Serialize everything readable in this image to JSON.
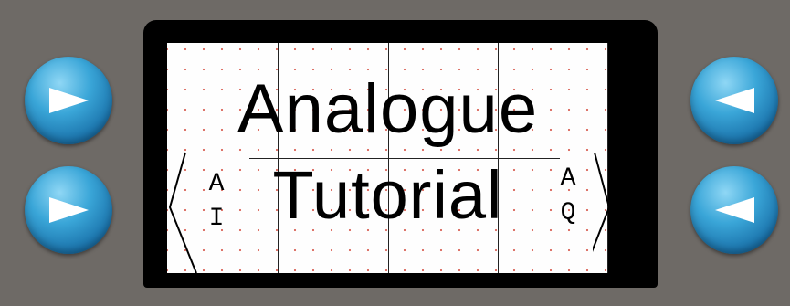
{
  "display": {
    "line1": "Analogue",
    "line2": "Tutorial",
    "left_label": [
      "A",
      "I"
    ],
    "right_label": [
      "A",
      "Q"
    ]
  },
  "buttons": {
    "left_top": {
      "icon": "arrow-right-icon"
    },
    "left_bottom": {
      "icon": "arrow-right-icon"
    },
    "right_top": {
      "icon": "arrow-left-icon"
    },
    "right_bottom": {
      "icon": "arrow-left-icon"
    }
  },
  "colors": {
    "panel": "#6e6a66",
    "bezel": "#000000",
    "screen": "#fefefe",
    "button_blue": "#2a8fc8",
    "grid_dot": "#d24a3c"
  }
}
